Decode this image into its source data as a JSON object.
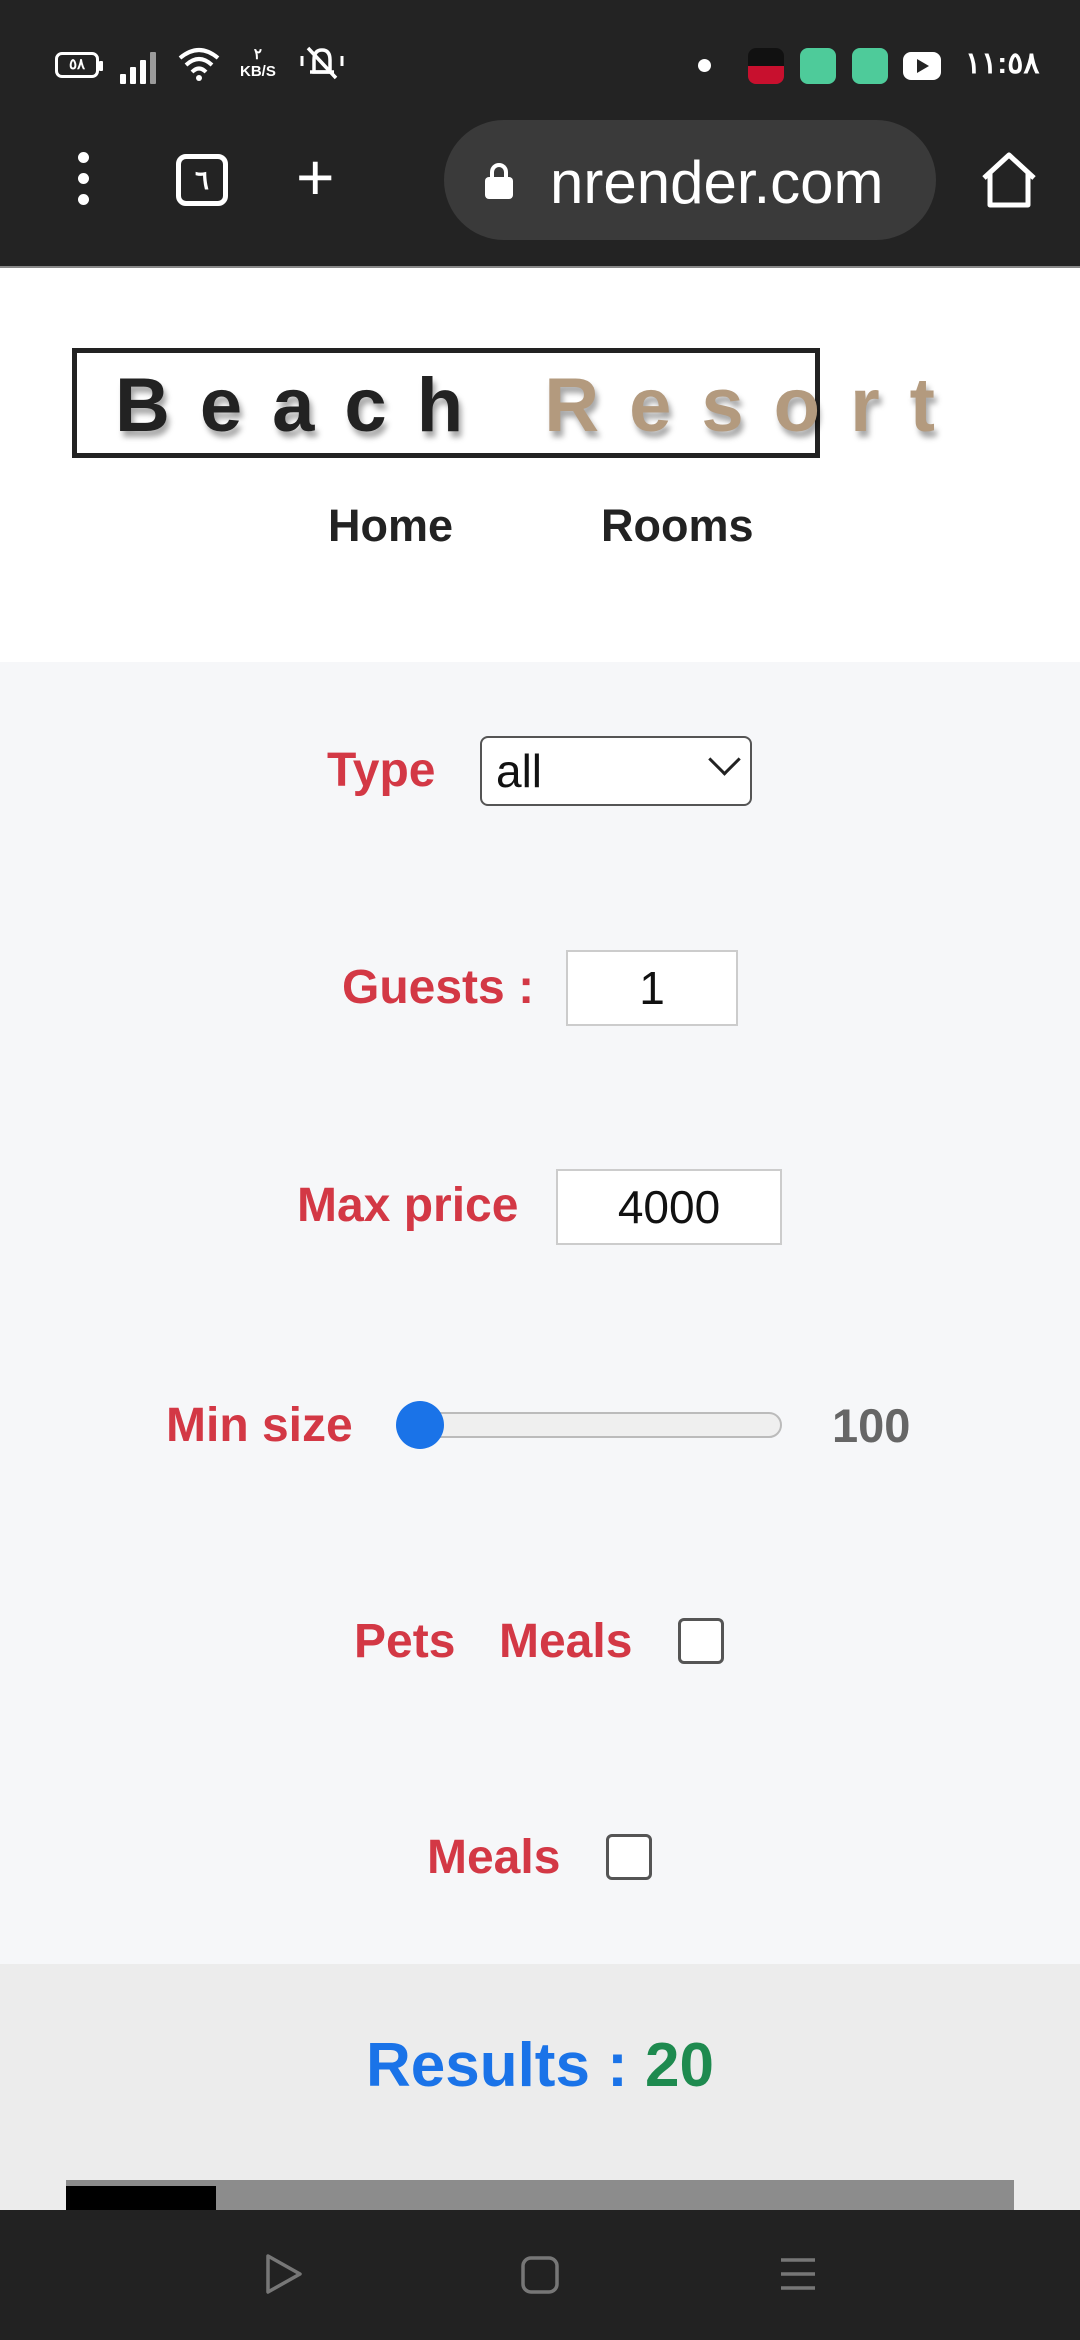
{
  "status_bar": {
    "battery": "٥٨",
    "net_speed_value": "٢",
    "net_speed_unit": "KB/S",
    "time": "١١:٥٨"
  },
  "browser": {
    "url": "nrender.com",
    "tab_count": "٦"
  },
  "site": {
    "logo_word1": "Beach",
    "logo_word2": "Resort",
    "nav": [
      "Home",
      "Rooms"
    ],
    "logo_gold_color": "#b39a7e"
  },
  "filters": {
    "type_label": "Type",
    "type_value": "all",
    "guests_label": "Guests :",
    "guests_value": "1",
    "max_price_label": "Max price",
    "max_price_value": "4000",
    "min_size_label": "Min size",
    "min_size_value": "100",
    "min_size_fraction": 0.0,
    "pets_label": "Pets",
    "pets_meals_label": "Meals",
    "meals_label": "Meals",
    "label_color": "#d33845",
    "slider_color": "#1a73e8"
  },
  "results": {
    "label": "Results :",
    "count": "20"
  },
  "icons": {
    "menu": "vertical-dots-icon",
    "tabs": "tabs-icon",
    "new_tab": "plus-icon",
    "lock": "lock-icon",
    "home": "home-icon",
    "nav_back": "play-back-icon",
    "nav_home": "square-home-icon",
    "nav_recents": "menu-lines-icon"
  }
}
